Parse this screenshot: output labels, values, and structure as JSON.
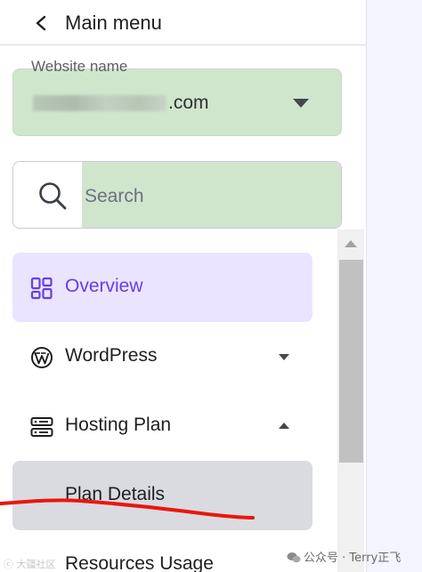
{
  "header": {
    "title": "Main menu",
    "back_icon": "chevron-left-icon"
  },
  "website_select": {
    "label": "Website name",
    "value_suffix": ".com",
    "dropdown_icon": "caret-down-icon"
  },
  "search": {
    "placeholder": "Search",
    "value": "",
    "icon": "search-icon"
  },
  "nav": {
    "items": [
      {
        "label": "Overview",
        "icon": "dashboard-grid-icon",
        "active": true
      },
      {
        "label": "WordPress",
        "icon": "wordpress-icon",
        "expander": "caret-down-icon"
      },
      {
        "label": "Hosting Plan",
        "icon": "server-icon",
        "expander": "caret-up-icon",
        "expanded": true
      },
      {
        "label": "Plan Details",
        "sub_item": true,
        "highlighted": true
      },
      {
        "label": "Resources Usage",
        "sub_item": true
      }
    ]
  },
  "watermark": {
    "left": "ⓒ 大疆社区",
    "right": "公众号 · Terry正飞"
  },
  "colors": {
    "accent": "#673de6",
    "active_bg": "#ebe4ff",
    "green_highlight": "#cfe6cd",
    "annotation": "#e8170e"
  }
}
